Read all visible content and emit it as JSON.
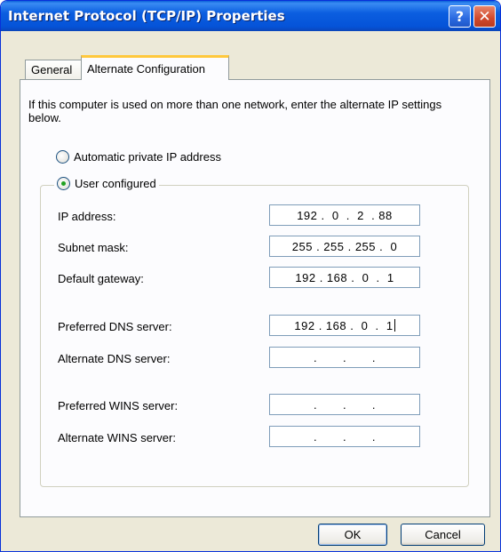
{
  "window": {
    "title": "Internet Protocol (TCP/IP) Properties",
    "help_glyph": "?",
    "close_glyph": "✕"
  },
  "tabs": [
    {
      "label": "General",
      "active": false
    },
    {
      "label": "Alternate Configuration",
      "active": true
    }
  ],
  "intro_text": "If this computer is used on more than one network, enter the alternate IP settings below.",
  "options": {
    "automatic_label": "Automatic private IP address",
    "automatic_selected": false,
    "user_label": "User configured",
    "user_selected": true
  },
  "fields": {
    "ip_address": {
      "label": "IP address:",
      "value": "192 .  0  .  2  . 88"
    },
    "subnet_mask": {
      "label": "Subnet mask:",
      "value": "255 . 255 . 255 .  0"
    },
    "default_gateway": {
      "label": "Default gateway:",
      "value": "192 . 168 .  0  .  1"
    },
    "preferred_dns": {
      "label": "Preferred DNS server:",
      "value": "192 . 168 .  0  .  1"
    },
    "alternate_dns": {
      "label": "Alternate DNS server:",
      "value": ".       .       ."
    },
    "preferred_wins": {
      "label": "Preferred WINS server:",
      "value": ".       .       ."
    },
    "alternate_wins": {
      "label": "Alternate WINS server:",
      "value": ".       .       ."
    }
  },
  "buttons": {
    "ok_label": "OK",
    "cancel_label": "Cancel"
  }
}
